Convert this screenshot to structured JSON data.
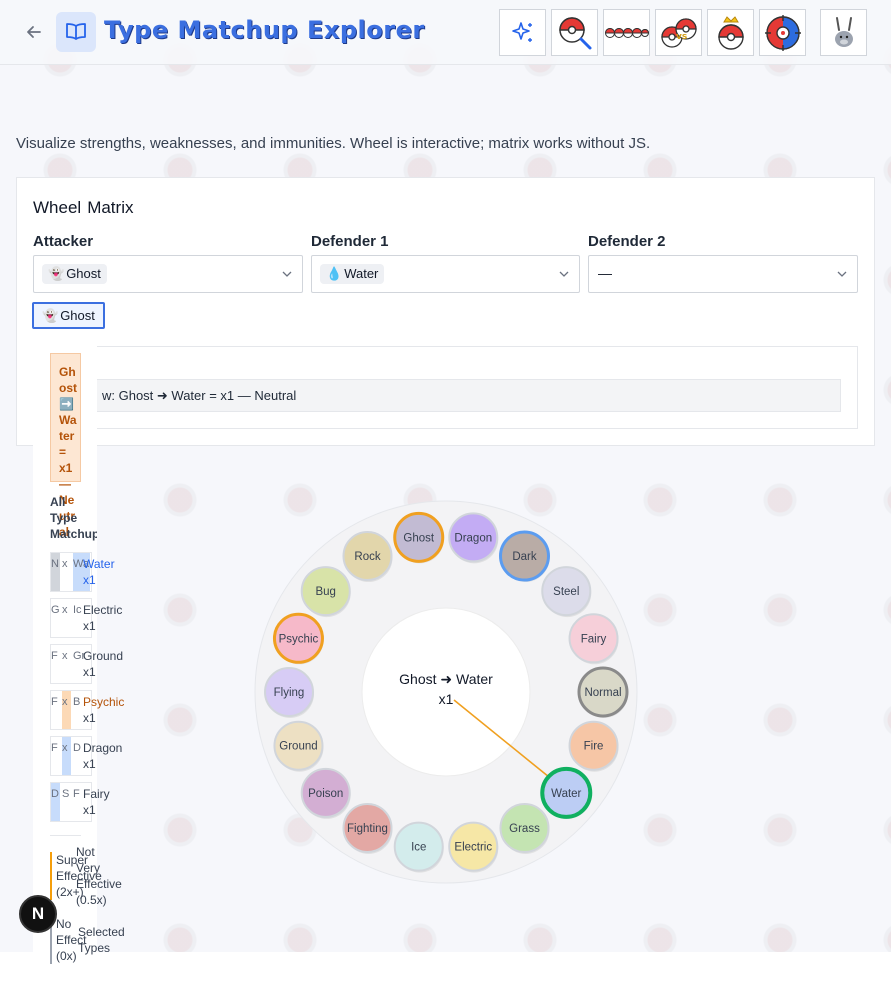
{
  "header": {
    "title": "Type Matchup Explorer",
    "tools": [
      {
        "icon": "sparkles-icon"
      },
      {
        "icon": "pokeball-search-icon"
      },
      {
        "icon": "pokeball-row-icon"
      },
      {
        "icon": "pokeball-versus-icon"
      },
      {
        "icon": "pokeball-crown-icon"
      },
      {
        "icon": "pokeball-target-icon"
      },
      {
        "icon": "rabbit-icon"
      }
    ]
  },
  "description": "Visualize strengths, weaknesses, and immunities. Wheel is interactive; matrix works without JS.",
  "tabs": [
    "Wheel",
    "Matrix"
  ],
  "fields": {
    "attacker": {
      "label": "Attacker",
      "value": "Ghost",
      "emoji": "👻"
    },
    "defender1": {
      "label": "Defender 1",
      "value": "Water",
      "emoji": "💧"
    },
    "defender2": {
      "label": "Defender 2",
      "value": "—"
    }
  },
  "selected_chip": {
    "emoji": "👻",
    "label": "Ghost"
  },
  "preview": "w: Ghost ➜ Water = x1 — Neutral",
  "result": {
    "lines": [
      "Ghost",
      "➡️",
      "Water",
      "=",
      "x1",
      "—",
      "Neutral"
    ]
  },
  "matchups": {
    "title_lines": [
      "All",
      "Type",
      "Matchups:"
    ],
    "rows": [
      {
        "a": "N",
        "b": "x",
        "c": "Wa",
        "text1": "Water",
        "text2": "x1"
      },
      {
        "a": "G",
        "b": "x",
        "c": "Ic",
        "text1": "Electric",
        "text2": "x1"
      },
      {
        "a": "F",
        "b": "x",
        "c": "Gr",
        "text1": "Ground",
        "text2": "x1"
      },
      {
        "a": "F",
        "b": "x",
        "c": "B",
        "text1": "Psychic",
        "text2": "x1"
      },
      {
        "a": "F",
        "b": "x",
        "c": "D",
        "text1": "Dragon",
        "text2": "x1"
      },
      {
        "a": "D",
        "b": "S",
        "c": "F",
        "text1": "Fairy",
        "text2": "x1"
      }
    ],
    "overlap": [
      "ter",
      "ctric",
      "ug",
      "nd",
      "ark",
      "Bug",
      "Grass",
      "Steel"
    ]
  },
  "legend": {
    "super": [
      "Super",
      "Effective",
      "(2x+)"
    ],
    "not_very": [
      "Not",
      "Very",
      "Effective",
      "(0.5x)"
    ],
    "no_effect": [
      "No",
      "Effect",
      "(0x)"
    ],
    "selected": [
      "Selected",
      "Types"
    ]
  },
  "wheel": {
    "center_line1": "Ghost ➜ Water",
    "center_line2": "x1",
    "types": [
      {
        "name": "Ghost",
        "color": "#c2bbd3",
        "ring": "#f0a020"
      },
      {
        "name": "Dragon",
        "color": "#c3acf4",
        "ring": ""
      },
      {
        "name": "Dark",
        "color": "#b9aca6",
        "ring": "#5b9cf0"
      },
      {
        "name": "Steel",
        "color": "#dcdcea",
        "ring": ""
      },
      {
        "name": "Fairy",
        "color": "#f6cfd9",
        "ring": ""
      },
      {
        "name": "Normal",
        "color": "#d9d8c8",
        "ring": "#8a8a8a"
      },
      {
        "name": "Fire",
        "color": "#f6c6a6",
        "ring": ""
      },
      {
        "name": "Water",
        "color": "#bccdf4",
        "ring": "#10b060"
      },
      {
        "name": "Grass",
        "color": "#c4e4b2",
        "ring": ""
      },
      {
        "name": "Electric",
        "color": "#f6e7a6",
        "ring": ""
      },
      {
        "name": "Ice",
        "color": "#d3ecec",
        "ring": ""
      },
      {
        "name": "Fighting",
        "color": "#e3a8a4",
        "ring": ""
      },
      {
        "name": "Poison",
        "color": "#d3aed3",
        "ring": ""
      },
      {
        "name": "Ground",
        "color": "#ede0c3",
        "ring": ""
      },
      {
        "name": "Flying",
        "color": "#d7ccf5",
        "ring": ""
      },
      {
        "name": "Psychic",
        "color": "#f6b9c9",
        "ring": "#f0a020"
      },
      {
        "name": "Bug",
        "color": "#d8e3a8",
        "ring": ""
      },
      {
        "name": "Rock",
        "color": "#e2d6ab",
        "ring": ""
      }
    ],
    "arrow_from": "Ghost",
    "arrow_to": "Water"
  },
  "badge": "N"
}
